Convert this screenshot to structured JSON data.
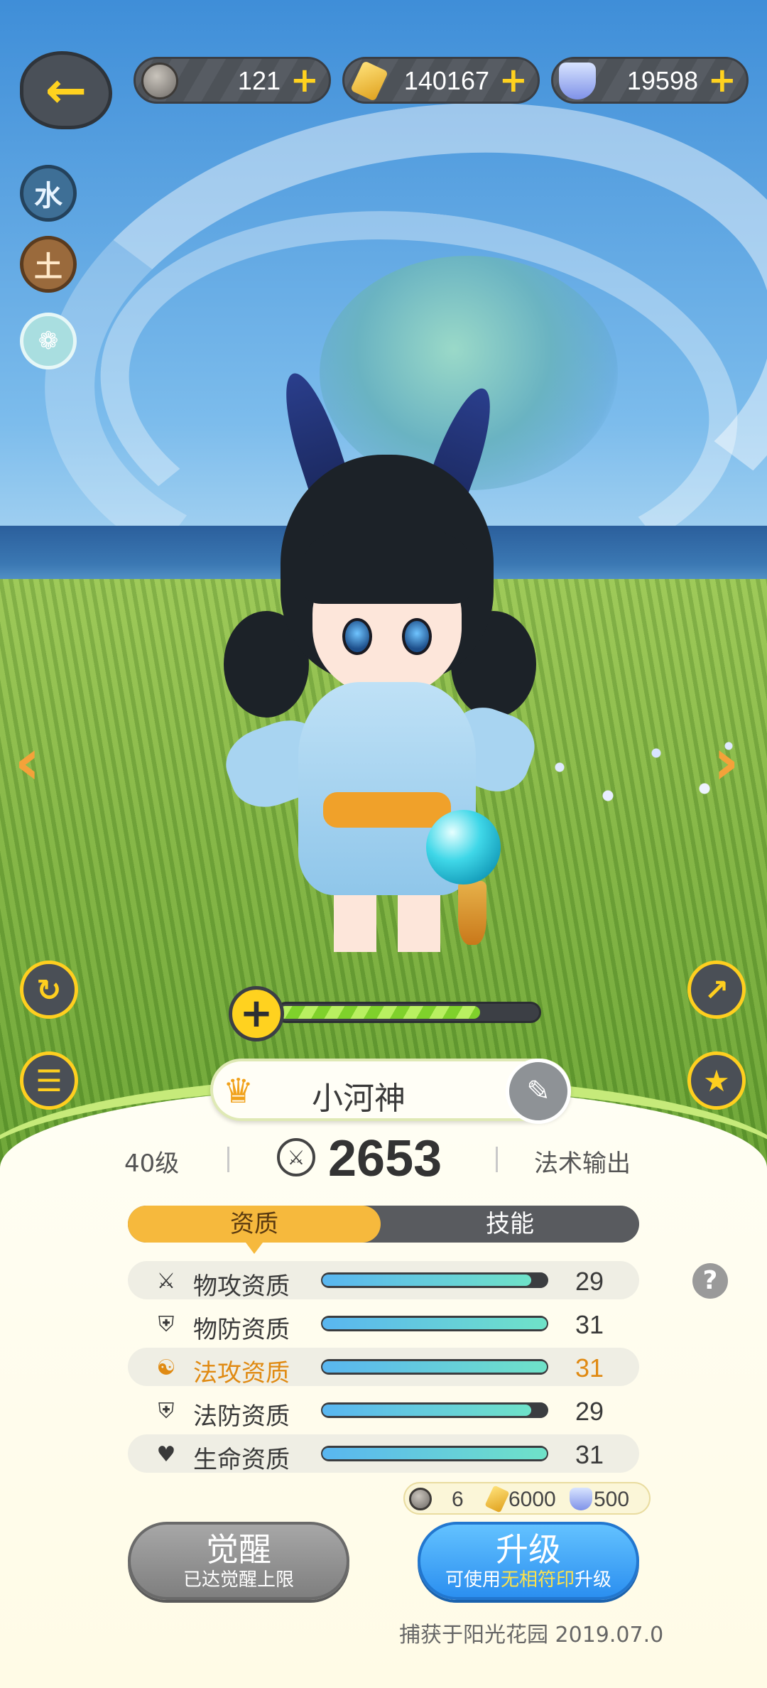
{
  "header": {
    "back_icon": "back-arrow-icon",
    "resources": [
      {
        "icon": "pet-coin-icon",
        "value": "121",
        "plus": "+"
      },
      {
        "icon": "gold-crystal-icon",
        "value": "140167",
        "plus": "+"
      },
      {
        "icon": "diamond-icon",
        "value": "19598",
        "plus": "+"
      }
    ]
  },
  "elements": [
    "水",
    "土",
    "灵"
  ],
  "pet": {
    "name": "小河神",
    "level": "40级",
    "power": "2653",
    "role": "法术输出",
    "exp_fraction": 0.78
  },
  "tabs": [
    "资质",
    "技能"
  ],
  "attributes": [
    {
      "icon": "sword-icon",
      "label": "物攻资质",
      "value": "29",
      "fill": 0.93,
      "highlight": false
    },
    {
      "icon": "shield-icon",
      "label": "物防资质",
      "value": "31",
      "fill": 1.0,
      "highlight": false
    },
    {
      "icon": "magic-swirl-icon",
      "label": "法攻资质",
      "value": "31",
      "fill": 1.0,
      "highlight": true
    },
    {
      "icon": "shield-icon",
      "label": "法防资质",
      "value": "29",
      "fill": 0.93,
      "highlight": false
    },
    {
      "icon": "heart-icon",
      "label": "生命资质",
      "value": "31",
      "fill": 1.0,
      "highlight": false
    }
  ],
  "cost": {
    "coin": "6",
    "gold": "6000",
    "diamond": "500"
  },
  "buttons": {
    "awaken_label": "觉醒",
    "awaken_sub": "已达觉醒上限",
    "upgrade_label": "升级",
    "upgrade_sub_pre": "可使用",
    "upgrade_sub_kw": "无相符印",
    "upgrade_sub_post": "升级"
  },
  "capture_text": "捕获于阳光花园  2019.07.0",
  "colors": {
    "accent": "#ffd21f",
    "tab_active": "#f6b93d",
    "upgrade": "#2b8ff0",
    "highlight": "#e08a12"
  }
}
